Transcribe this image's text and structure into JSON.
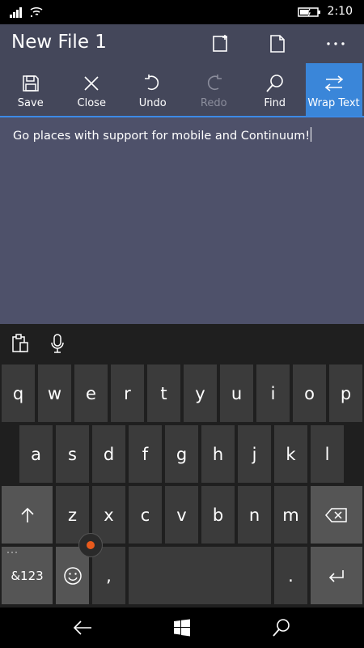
{
  "status": {
    "time": "2:10"
  },
  "app": {
    "title": "New File 1"
  },
  "toolbar": {
    "save": "Save",
    "close": "Close",
    "undo": "Undo",
    "redo": "Redo",
    "find": "Find",
    "wrap": "Wrap Text"
  },
  "editor": {
    "text": "Go places with support for mobile and Continuum!"
  },
  "keyboard": {
    "row1": [
      "q",
      "w",
      "e",
      "r",
      "t",
      "y",
      "u",
      "i",
      "o",
      "p"
    ],
    "row2": [
      "a",
      "s",
      "d",
      "f",
      "g",
      "h",
      "j",
      "k",
      "l"
    ],
    "row3": [
      "z",
      "x",
      "c",
      "v",
      "b",
      "n",
      "m"
    ],
    "symbols": "&123",
    "comma": ",",
    "period": "."
  },
  "colors": {
    "accent": "#3a86d9",
    "appbar": "#44475a",
    "editor": "#4e516a"
  }
}
